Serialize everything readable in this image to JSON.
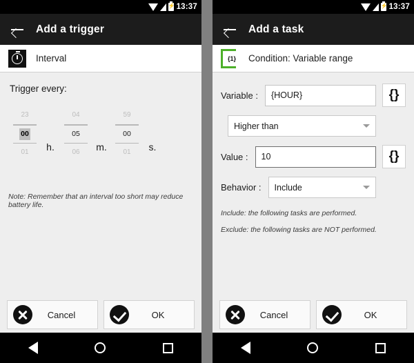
{
  "statusbar": {
    "time": "13:37",
    "icons": [
      "wifi-icon",
      "signal-icon",
      "battery-charging-icon"
    ]
  },
  "left_panel": {
    "actionbar": {
      "back_icon": "back-arrow-icon",
      "title": "Add a trigger"
    },
    "header": {
      "icon": "stopwatch-icon",
      "label": "Interval"
    },
    "trigger_label": "Trigger every:",
    "timepicker": {
      "columns": [
        {
          "unit": "h.",
          "previous": "23",
          "current": "00",
          "next": "01",
          "selected": true
        },
        {
          "unit": "m.",
          "previous": "04",
          "current": "05",
          "next": "06",
          "selected": false
        },
        {
          "unit": "s.",
          "previous": "59",
          "current": "00",
          "next": "01",
          "selected": false
        }
      ]
    },
    "note": "Note: Remember that an interval too short may reduce battery life.",
    "buttons": {
      "cancel": "Cancel",
      "ok": "OK"
    }
  },
  "right_panel": {
    "actionbar": {
      "back_icon": "back-arrow-icon",
      "title": "Add a task"
    },
    "header": {
      "icon": "variable-bracket-icon",
      "icon_text": "{1}",
      "label": "Condition: Variable range"
    },
    "form": {
      "variable_label": "Variable :",
      "variable_value": "{HOUR}",
      "variable_braces_button": "{}",
      "comparison_value": "Higher than",
      "value_label": "Value :",
      "value_value": "10",
      "value_braces_button": "{}",
      "behavior_label": "Behavior :",
      "behavior_value": "Include"
    },
    "legend": [
      "Include: the following tasks are performed.",
      "Exclude: the following tasks are NOT performed."
    ],
    "buttons": {
      "cancel": "Cancel",
      "ok": "OK"
    }
  },
  "navbar": {
    "back": "nav-back-icon",
    "home": "nav-home-icon",
    "recents": "nav-recents-icon"
  },
  "colors": {
    "accent_green": "#4caf29",
    "actionbar_bg": "#1c1c1c",
    "body_bg": "#eeeeee"
  }
}
